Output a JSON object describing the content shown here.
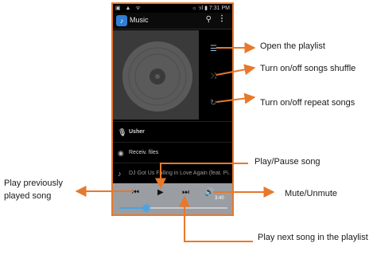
{
  "status_bar": {
    "left_icons": "▣ ▲ ᯤ",
    "right_text": "☼ ⁝ıl ▮ 7:31 PM"
  },
  "app": {
    "icon_glyph": "♪",
    "title": "Music"
  },
  "action_icons": {
    "search": "⚲",
    "menu": "⋮"
  },
  "side_icons": {
    "playlist": "☰",
    "shuffle": "⤨",
    "repeat": "↻"
  },
  "now_playing": {
    "artist": "Usher",
    "album": "Receiv. files",
    "track": "DJ Got Us Falling in Love Again (feat. Pi..."
  },
  "row_icons": {
    "artist": "🎙",
    "album": "◉",
    "track": "♪"
  },
  "controls": {
    "prev": "⏮",
    "play": "▶",
    "next": "⏭",
    "mute": "🔊",
    "time": "3:40",
    "progress": 0.25
  },
  "colors": {
    "arrow": "#e8782a",
    "frame": "#e8782a",
    "accent": "#4ba3e6",
    "controls_bg": "#9a9ea3"
  },
  "callouts": {
    "playlist": "Open the playlist",
    "shuffle": "Turn on/off songs shuffle",
    "repeat": "Turn on/off repeat songs",
    "play_pause": "Play/Pause song",
    "mute": "Mute/Unmute",
    "prev": "Play previously played song",
    "next": "Play next song in the playlist"
  }
}
